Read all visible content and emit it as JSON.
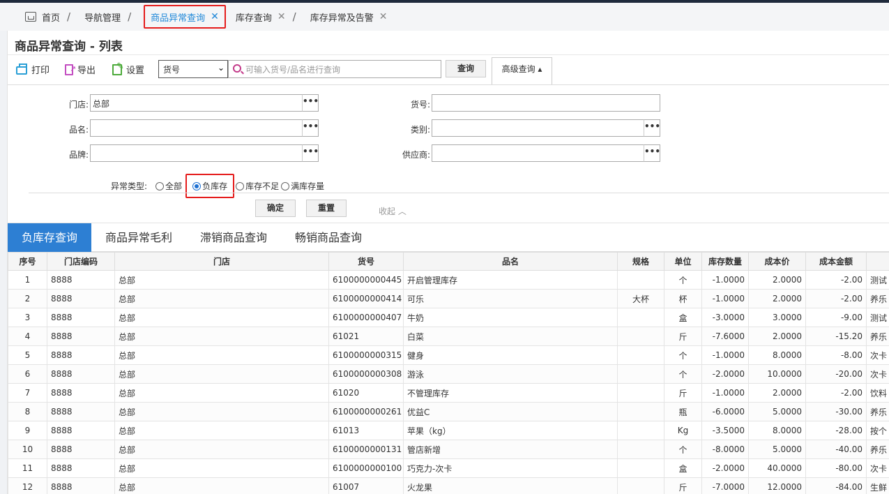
{
  "nav_tabs": [
    {
      "label": "首页"
    },
    {
      "label": "导航管理"
    },
    {
      "label": "商品异常查询"
    },
    {
      "label": "库存查询"
    },
    {
      "label": "库存异常及告警"
    }
  ],
  "page": {
    "title": "商品异常查询 - 列表"
  },
  "toolbar": {
    "print_label": "打印",
    "export_label": "导出",
    "settings_label": "设置",
    "search_field_selected": "货号",
    "search_placeholder": "可输入货号/品名进行查询",
    "query_label": "查询",
    "advanced_label": "高级查询 ▴"
  },
  "form": {
    "store_label": "门店:",
    "store_value": "总部",
    "item_no_label": "货号:",
    "item_no_value": "",
    "name_label": "品名:",
    "name_value": "",
    "category_label": "类别:",
    "category_value": "",
    "brand_label": "品牌:",
    "brand_value": "",
    "supplier_label": "供应商:",
    "supplier_value": "",
    "dots_label": "•••",
    "anomaly_label": "异常类型:",
    "anomaly_options": [
      "全部",
      "负库存",
      "库存不足",
      "满库存量"
    ],
    "anomaly_selected": 1,
    "confirm_label": "确定",
    "reset_label": "重置",
    "collapse_label": "收起 ︿"
  },
  "sub_tabs": [
    "负库存查询",
    "商品异常毛利",
    "滞销商品查询",
    "畅销商品查询"
  ],
  "sub_tab_active": 0,
  "table": {
    "columns": [
      "序号",
      "门店编码",
      "门店",
      "货号",
      "品名",
      "规格",
      "单位",
      "库存数量",
      "成本价",
      "成本金额",
      ""
    ],
    "rows": [
      [
        "1",
        "8888",
        "总部",
        "6100000000445",
        "开启管理库存",
        "",
        "个",
        "-1.0000",
        "2.0000",
        "-2.00",
        "测试"
      ],
      [
        "2",
        "8888",
        "总部",
        "6100000000414",
        "可乐",
        "大杯",
        "杯",
        "-1.0000",
        "2.0000",
        "-2.00",
        "养乐"
      ],
      [
        "3",
        "8888",
        "总部",
        "6100000000407",
        "牛奶",
        "",
        "盒",
        "-3.0000",
        "3.0000",
        "-9.00",
        "测试"
      ],
      [
        "4",
        "8888",
        "总部",
        "61021",
        "白菜",
        "",
        "斤",
        "-7.6000",
        "2.0000",
        "-15.20",
        "养乐"
      ],
      [
        "5",
        "8888",
        "总部",
        "6100000000315",
        "健身",
        "",
        "个",
        "-1.0000",
        "8.0000",
        "-8.00",
        "次卡"
      ],
      [
        "6",
        "8888",
        "总部",
        "6100000000308",
        "游泳",
        "",
        "个",
        "-2.0000",
        "10.0000",
        "-20.00",
        "次卡"
      ],
      [
        "7",
        "8888",
        "总部",
        "61020",
        "不管理库存",
        "",
        "斤",
        "-1.0000",
        "2.0000",
        "-2.00",
        "饮料"
      ],
      [
        "8",
        "8888",
        "总部",
        "6100000000261",
        "优益C",
        "",
        "瓶",
        "-6.0000",
        "5.0000",
        "-30.00",
        "养乐"
      ],
      [
        "9",
        "8888",
        "总部",
        "61013",
        "苹果（kg）",
        "",
        "Kg",
        "-3.5000",
        "8.0000",
        "-28.00",
        "按个"
      ],
      [
        "10",
        "8888",
        "总部",
        "6100000000131",
        "管店新增",
        "",
        "个",
        "-8.0000",
        "5.0000",
        "-40.00",
        "养乐"
      ],
      [
        "11",
        "8888",
        "总部",
        "6100000000100",
        "巧克力-次卡",
        "",
        "盒",
        "-2.0000",
        "40.0000",
        "-80.00",
        "次卡"
      ],
      [
        "12",
        "8888",
        "总部",
        "61007",
        "火龙果",
        "",
        "斤",
        "-7.0000",
        "12.0000",
        "-84.00",
        "生鲜"
      ]
    ]
  }
}
